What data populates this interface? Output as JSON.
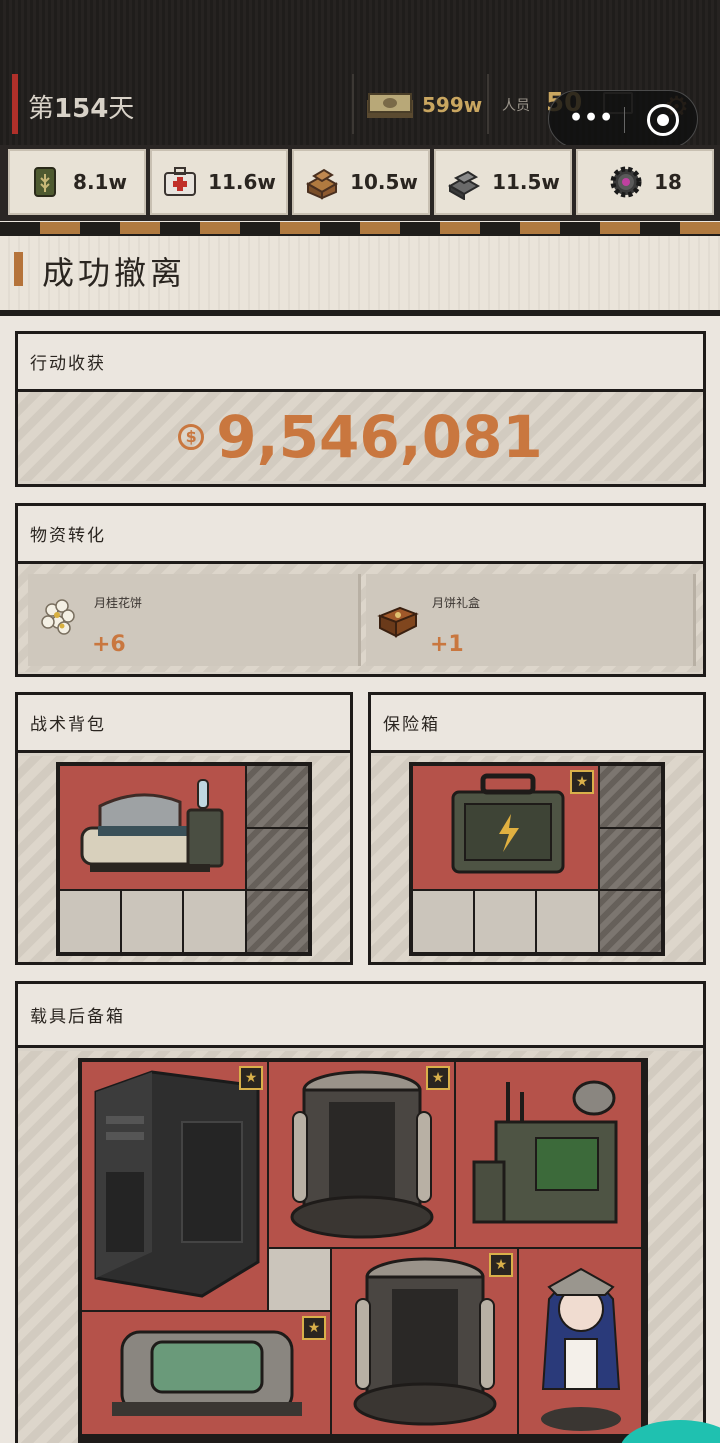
{
  "status": {
    "day_prefix": "第",
    "day_number": "154",
    "day_suffix": "天",
    "cash": "599w",
    "staff_label": "人员",
    "staff_count": "50"
  },
  "resources": [
    {
      "icon": "grain-sack-icon",
      "value": "8.1w"
    },
    {
      "icon": "medkit-icon",
      "value": "11.6w"
    },
    {
      "icon": "wood-planks-icon",
      "value": "10.5w"
    },
    {
      "icon": "metal-ingot-icon",
      "value": "11.5w"
    },
    {
      "icon": "gear-part-icon",
      "value": "18"
    }
  ],
  "header": {
    "title": "成功撤离"
  },
  "income_panel": {
    "title": "行动收获",
    "currency_symbol": "$",
    "amount": "9,546,081"
  },
  "conversion_panel": {
    "title": "物资转化",
    "items": [
      {
        "name": "月桂花饼",
        "qty": "+6",
        "icon": "flower-icon"
      },
      {
        "name": "月饼礼盒",
        "qty": "+1",
        "icon": "gift-box-icon"
      }
    ]
  },
  "backpack_panel": {
    "title": "战术背包",
    "items": [
      {
        "icon": "medical-pod-icon",
        "starred": false
      }
    ]
  },
  "safe_panel": {
    "title": "保险箱",
    "items": [
      {
        "icon": "battery-case-icon",
        "starred": true
      }
    ]
  },
  "vehicle_panel": {
    "title": "载具后备箱",
    "items": [
      {
        "icon": "server-tower-icon",
        "starred": true
      },
      {
        "icon": "reactor-core-icon",
        "starred": true
      },
      {
        "icon": "radio-station-icon",
        "starred": false
      },
      {
        "icon": "reactor-core-icon",
        "starred": true
      },
      {
        "icon": "cryo-capsule-icon",
        "starred": true
      },
      {
        "icon": "maid-figure-icon",
        "starred": false
      }
    ]
  },
  "colors": {
    "accent": "#c9773f",
    "slot_item": "#b5524a",
    "cash": "#c9a660"
  }
}
